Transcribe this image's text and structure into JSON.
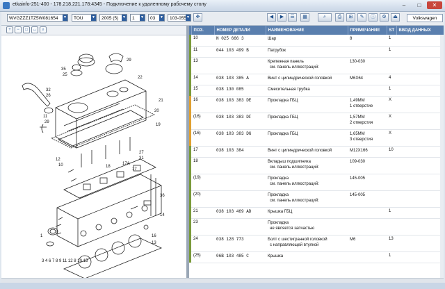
{
  "window": {
    "title": "etkainfo-251-400 - 178.218.221.178:4345 - Подключение к удаленному рабочему столу",
    "controls": {
      "minimize": "–",
      "maximize": "□",
      "close": "✕"
    }
  },
  "toolbar": {
    "vin": "WVGZZZ1TZ5W081654",
    "model": "TOU",
    "year": "2005 (5)",
    "group": "1",
    "subgroup": "03",
    "illustration": "103-055",
    "brand": "Volkswagen"
  },
  "drawing": {
    "callouts": [
      "35",
      "25",
      "29",
      "22",
      "32",
      "26",
      "21",
      "20",
      "11",
      "29",
      "19",
      "12",
      "27",
      "31",
      "10",
      "18",
      "17A",
      "17",
      "36",
      "14",
      "16",
      "13",
      "1",
      "3",
      "4",
      "6",
      "7",
      "8",
      "9",
      "11",
      "12",
      "10",
      "15"
    ],
    "bottom_label": "3 4 6 7 8   9 11 12 8 10 15"
  },
  "table": {
    "headers": [
      "ПОЗ.",
      "НОМЕР ДЕТАЛИ",
      "НАИМЕНОВАНИЕ",
      "ПРИМЕЧАНИЕ",
      "ST",
      "ВВОД ДАННЫХ"
    ],
    "rows": [
      {
        "pos": "10",
        "number": "N  025 666 3",
        "name": [
          "Шар"
        ],
        "note": [
          "8"
        ],
        "st": "1",
        "mark": "#7a9a3a"
      },
      {
        "pos": "11",
        "number": "044 103 499 B",
        "name": [
          "Патрубок"
        ],
        "note": [
          ""
        ],
        "st": "1",
        "mark": "#7a9a3a"
      },
      {
        "pos": "13",
        "number": "",
        "name": [
          "Крепежная панель",
          "см. панель иллюстраций:"
        ],
        "note": [
          "",
          "130-030"
        ],
        "st": "",
        "mark": "#7a9a3a"
      },
      {
        "pos": "14",
        "number": "038 103 385 A",
        "name": [
          "Винт с цилиндрической головкой"
        ],
        "note": [
          "M6X64"
        ],
        "st": "4",
        "mark": "#7a9a3a"
      },
      {
        "pos": "15",
        "number": "038 130 085",
        "name": [
          "Смесительная трубка"
        ],
        "note": [
          ""
        ],
        "st": "1",
        "mark": "#7a9a3a"
      },
      {
        "pos": "16",
        "number": "038 103 383 DE",
        "name": [
          "Прокладка ГБЦ"
        ],
        "note": [
          "1,49MM",
          "1 отверстие"
        ],
        "st": "X",
        "mark": "#e0a030"
      },
      {
        "pos": "(16)",
        "number": "038 103 383 DF",
        "name": [
          "Прокладка ГБЦ"
        ],
        "note": [
          "1,57MM",
          "2 отверстия"
        ],
        "st": "X",
        "mark": "#e0a030"
      },
      {
        "pos": "(16)",
        "number": "038 103 383 DG",
        "name": [
          "Прокладка ГБЦ"
        ],
        "note": [
          "1,65MM",
          "3 отверстия"
        ],
        "st": "X",
        "mark": "#e0a030"
      },
      {
        "pos": "17",
        "number": "038 103 384",
        "name": [
          "Винт с цилиндрической головкой"
        ],
        "note": [
          "M12X166"
        ],
        "st": "10",
        "mark": "#7a9a3a"
      },
      {
        "pos": "18",
        "number": "",
        "name": [
          "Вкладыш подшипника",
          "см. панель иллюстраций:"
        ],
        "note": [
          "",
          "109-030"
        ],
        "st": "",
        "mark": "#7a9a3a"
      },
      {
        "pos": "(19)",
        "number": "",
        "name": [
          "Прокладка",
          "см. панель иллюстраций:"
        ],
        "note": [
          "",
          "145-005"
        ],
        "st": "",
        "mark": "#7a9a3a"
      },
      {
        "pos": "(20)",
        "number": "",
        "name": [
          "Прокладка",
          "см. панель иллюстраций:"
        ],
        "note": [
          "",
          "145-005"
        ],
        "st": "",
        "mark": "#7a9a3a"
      },
      {
        "pos": "21",
        "number": "038 103 469 AD",
        "name": [
          "Крышка ГБЦ"
        ],
        "note": [
          ""
        ],
        "st": "1",
        "mark": "#7a9a3a"
      },
      {
        "pos": "23",
        "number": "",
        "name": [
          "Прокладка",
          "не является запчастью"
        ],
        "note": [
          ""
        ],
        "st": "",
        "mark": "#7a9a3a"
      },
      {
        "pos": "24",
        "number": "038 128 773",
        "name": [
          "Болт с шестигранной головкой",
          "с направляющей втулкой"
        ],
        "note": [
          "M6"
        ],
        "st": "13",
        "mark": "#7a9a3a"
      },
      {
        "pos": "(25)",
        "number": "06B 103 485 C",
        "name": [
          "Крышка"
        ],
        "note": [
          ""
        ],
        "st": "1",
        "mark": "#7a9a3a"
      }
    ]
  }
}
